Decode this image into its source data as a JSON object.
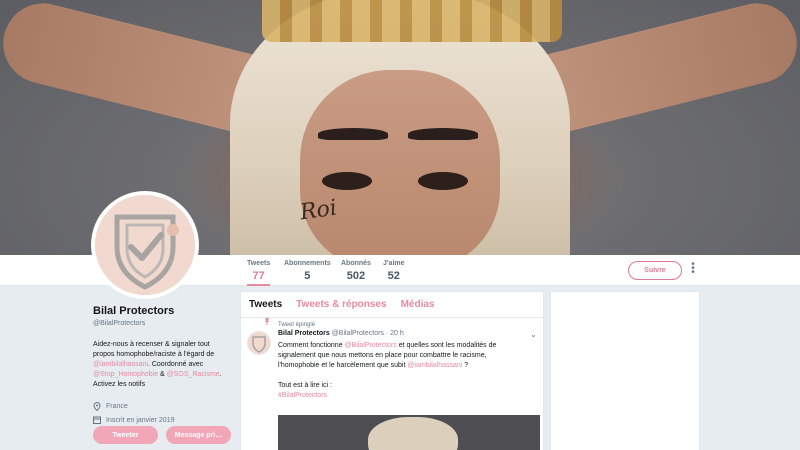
{
  "profile": {
    "name": "Bilal Protectors",
    "handle": "@BilalProtectors",
    "bio": {
      "line1": "Aidez-nous à recenser & signaler tout",
      "line2": "propos homophobe/raciste à l'égard de",
      "mention1": "@iambilalhassani",
      "mid": ". Coordonné avec",
      "mention2": "@Stop_Homophobie",
      "amp": " & ",
      "mention3": "@SOS_Racisme",
      "end": ".",
      "line_last": "Activez les notifs"
    },
    "location": "France",
    "joined": "Inscrit en janvier 2019",
    "tweet_button": "Tweeter",
    "message_button": "Message pri…"
  },
  "stats": [
    {
      "label": "Tweets",
      "value": "77"
    },
    {
      "label": "Abonnements",
      "value": "5"
    },
    {
      "label": "Abonnés",
      "value": "502"
    },
    {
      "label": "J'aime",
      "value": "52"
    }
  ],
  "follow_button": "Suivre",
  "banner": {
    "cheek_text": "Roi"
  },
  "tabs": [
    "Tweets",
    "Tweets & réponses",
    "Médias"
  ],
  "tweet": {
    "pinned_label": "Tweet épinglé",
    "author": "Bilal Protectors",
    "handle": "@BilalProtectors",
    "time": "· 20 h",
    "body_1a": "Comment fonctionne ",
    "body_1m": "@BilalProtectors",
    "body_1b": " et quelles sont les modalités de",
    "body_2": "signalement que nous mettons en place pour combattre le racisme,",
    "body_3a": "l'homophobie et le harcèlement que subit ",
    "body_3m": "@iambilalhassani",
    "body_3b": " ?",
    "body_4": "Tout est à lire ici :",
    "hashtag": "#BilalProtectors"
  },
  "colors": {
    "accent": "#e88aa0",
    "text": "#14171a",
    "muted": "#657786",
    "background": "#e6ecf0"
  }
}
